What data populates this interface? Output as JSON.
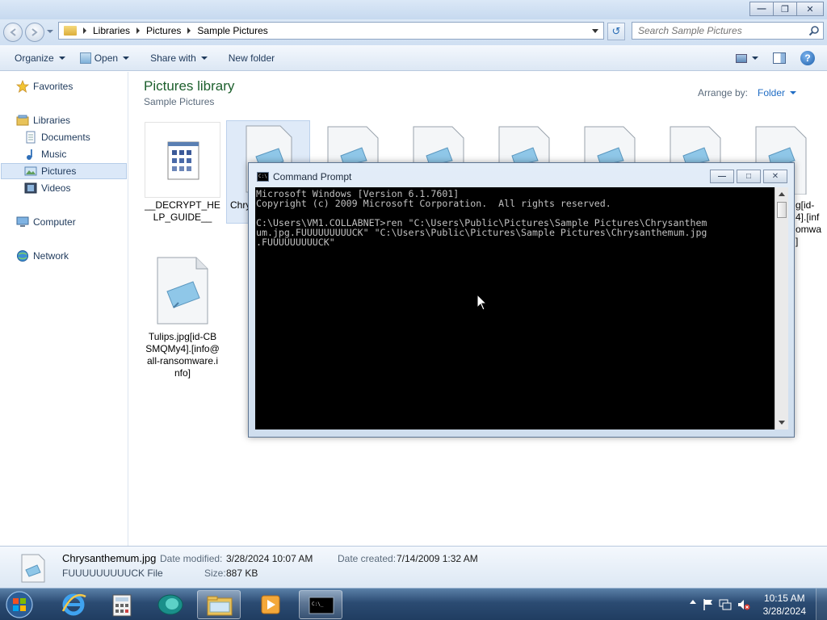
{
  "explorer": {
    "breadcrumb": [
      "Libraries",
      "Pictures",
      "Sample Pictures"
    ],
    "search_placeholder": "Search Sample Pictures",
    "toolbar": {
      "organize": "Organize",
      "open": "Open",
      "share_with": "Share with",
      "new_folder": "New folder"
    },
    "nav": {
      "favorites": "Favorites",
      "libraries": "Libraries",
      "documents": "Documents",
      "music": "Music",
      "pictures": "Pictures",
      "videos": "Videos",
      "computer": "Computer",
      "network": "Network"
    },
    "library_title": "Pictures library",
    "library_subtitle": "Sample Pictures",
    "arrange_label": "Arrange by:",
    "arrange_value": "Folder",
    "files": {
      "decrypt": "__DECRYPT_HELP_GUIDE__",
      "chrysanthemum_partial": "Chry",
      "right_partial_1": "g[id-",
      "right_partial_2": "4].[inf",
      "right_partial_3": "omwa",
      "right_partial_4": "]",
      "tulips": "Tulips.jpg[id-CBSMQMy4].[info@all-ransomware.info]"
    },
    "details": {
      "file_name": "Chrysanthemum.jpg",
      "file_type": "FUUUUUUUUUCK File",
      "date_modified_label": "Date modified:",
      "date_modified": "3/28/2024 10:07 AM",
      "date_created_label": "Date created:",
      "date_created": "7/14/2009 1:32 AM",
      "size_label": "Size:",
      "size": "887 KB"
    }
  },
  "cmd": {
    "title": "Command Prompt",
    "lines": [
      "Microsoft Windows [Version 6.1.7601]",
      "Copyright (c) 2009 Microsoft Corporation.  All rights reserved.",
      "",
      "C:\\Users\\VM1.COLLABNET>ren \"C:\\Users\\Public\\Pictures\\Sample Pictures\\Chrysanthem",
      "um.jpg.FUUUUUUUUUCK\" \"C:\\Users\\Public\\Pictures\\Sample Pictures\\Chrysanthemum.jpg",
      ".FUUUUUUUUUCK\""
    ]
  },
  "taskbar": {
    "time": "10:15 AM",
    "date": "3/28/2024"
  },
  "colors": {
    "accent": "#1f6cc4",
    "library_title": "#1c5f2c",
    "console_bg": "#000000",
    "console_fg": "#c0c0c0"
  }
}
